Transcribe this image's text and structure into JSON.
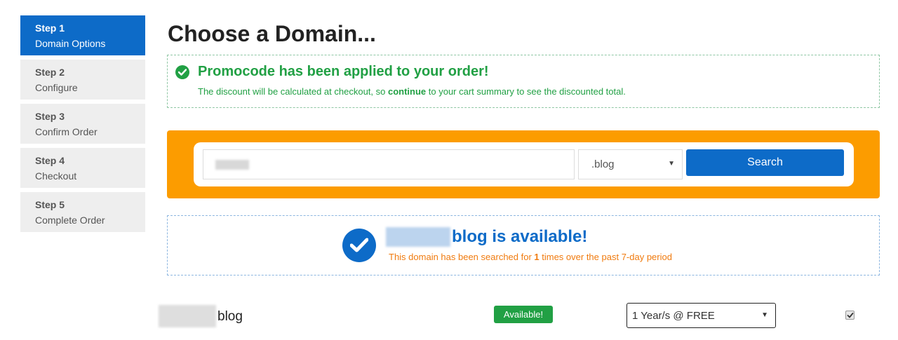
{
  "steps": [
    {
      "num": "Step 1",
      "label": "Domain Options",
      "active": true
    },
    {
      "num": "Step 2",
      "label": "Configure"
    },
    {
      "num": "Step 3",
      "label": "Confirm Order"
    },
    {
      "num": "Step 4",
      "label": "Checkout"
    },
    {
      "num": "Step 5",
      "label": "Complete Order"
    }
  ],
  "page": {
    "title": "Choose a Domain..."
  },
  "promo": {
    "icon": "check-circle-icon",
    "heading": "Promocode has been applied to your order!",
    "text_before": "The discount will be calculated at checkout, so ",
    "text_bold": "continue",
    "text_after": " to your cart summary to see the discounted total."
  },
  "search": {
    "input_value": "",
    "tld_selected": ".blog",
    "button_label": "Search"
  },
  "availability": {
    "icon": "check-circle-icon",
    "heading": "blog is available!",
    "sub_before": "This domain has been searched for ",
    "sub_count": "1",
    "sub_after": " times over the past 7-day period"
  },
  "result": {
    "name": "blog",
    "status_badge": "Available!",
    "period_selected": "1 Year/s @ FREE",
    "selected": true
  },
  "colors": {
    "primary": "#0d6bc8",
    "success": "#21a044",
    "orange": "#fc9c00",
    "warning_text": "#f07b0f"
  }
}
